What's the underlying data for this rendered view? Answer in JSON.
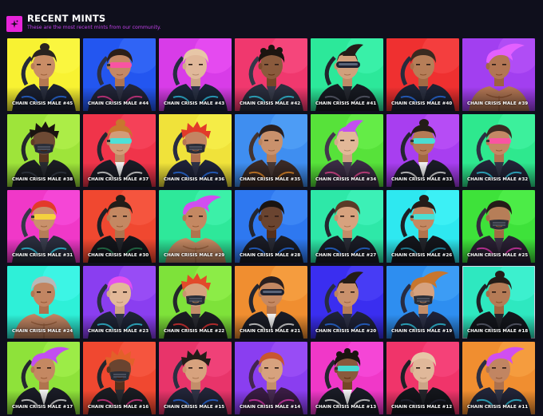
{
  "header": {
    "title": "RECENT MINTS",
    "subtitle": "These are the most recent mints from our community.",
    "logo_icon": "sparkle-icon"
  },
  "colors": {
    "accent": "#e724d9",
    "subtitle": "#c040e8",
    "background": "#0f0f1c"
  },
  "mints": [
    {
      "name": "CHAIN CRISIS MALE #45",
      "bg": "#f8f232",
      "skin": "#c98d66",
      "hair": "#2a2320",
      "jacket": "#1b2030",
      "accent": "#2e7bff",
      "eyewear": "none",
      "style": "bun"
    },
    {
      "name": "CHAIN CRISIS MALE #44",
      "bg": "#2356f0",
      "skin": "#c48865",
      "hair": "#2c1e18",
      "jacket": "#222538",
      "accent": "#ff3fa0",
      "eyewear": "goggles-pink",
      "style": "short"
    },
    {
      "name": "CHAIN CRISIS MALE #43",
      "bg": "#d83ce8",
      "skin": "#e0b89a",
      "hair": "#e7c6a7",
      "jacket": "#1b2337",
      "accent": "#36d8ff",
      "eyewear": "none",
      "style": "short"
    },
    {
      "name": "CHAIN CRISIS MALE #42",
      "bg": "#f0386e",
      "skin": "#8a5a3c",
      "hair": "#1c1410",
      "jacket": "#2a2e3e",
      "accent": "#38e0ff",
      "eyewear": "none",
      "style": "curly"
    },
    {
      "name": "CHAIN CRISIS MALE #41",
      "bg": "#2ce89a",
      "skin": "#d1a07c",
      "hair": "#241c18",
      "jacket": "#171a22",
      "accent": "#6a6f80",
      "eyewear": "visor-dark",
      "style": "mohawk"
    },
    {
      "name": "CHAIN CRISIS MALE #40",
      "bg": "#ef3030",
      "skin": "#b67e58",
      "hair": "#3a2a20",
      "jacket": "#1d2233",
      "accent": "#2e7bff",
      "eyewear": "none",
      "style": "short"
    },
    {
      "name": "CHAIN CRISIS MALE #39",
      "bg": "#a23ff0",
      "skin": "#b27654",
      "hair": "#e360ff",
      "jacket": "none",
      "accent": "#c06fff",
      "eyewear": "none",
      "style": "swept"
    },
    {
      "name": "CHAIN CRISIS MALE #38",
      "bg": "#9ee43a",
      "skin": "#6e4a34",
      "hair": "#1a1410",
      "jacket": "#1a1c22",
      "accent": "#3a3f4c",
      "eyewear": "mask",
      "style": "spiky"
    },
    {
      "name": "CHAIN CRISIS MALE #37",
      "bg": "#f0344a",
      "skin": "#d39c78",
      "hair": "#c8762e",
      "jacket": "#1a1c26",
      "accent": "#ffffff",
      "eyewear": "goggles-cyan",
      "style": "bun"
    },
    {
      "name": "CHAIN CRISIS MALE #36",
      "bg": "#f0e23a",
      "skin": "#c48462",
      "hair": "#e23a2a",
      "jacket": "#1e2238",
      "accent": "#2e7bff",
      "eyewear": "mask",
      "style": "spiky"
    },
    {
      "name": "CHAIN CRISIS MALE #35",
      "bg": "#3f8ef0",
      "skin": "#c9916c",
      "hair": "#2a2020",
      "jacket": "#3a2a26",
      "accent": "#ff9a2e",
      "eyewear": "none",
      "style": "short"
    },
    {
      "name": "CHAIN CRISIS MALE #34",
      "bg": "#57e23a",
      "skin": "#e2b898",
      "hair": "#c24ff0",
      "jacket": "#3a2c44",
      "accent": "#ff4fa0",
      "eyewear": "none",
      "style": "mohawk"
    },
    {
      "name": "CHAIN CRISIS MALE #33",
      "bg": "#a83ef0",
      "skin": "#b57b56",
      "hair": "#241c18",
      "jacket": "#1a1c26",
      "accent": "#ffffff",
      "eyewear": "goggles-cyan",
      "style": "bun"
    },
    {
      "name": "CHAIN CRISIS MALE #32",
      "bg": "#2ee88e",
      "skin": "#c48865",
      "hair": "#3a2a22",
      "jacket": "#222538",
      "accent": "#38e0ff",
      "eyewear": "goggles-pink",
      "style": "short"
    },
    {
      "name": "CHAIN CRISIS MALE #31",
      "bg": "#f038c8",
      "skin": "#c9916c",
      "hair": "#e23a2a",
      "jacket": "#2a2e3e",
      "accent": "#38e0ff",
      "eyewear": "goggles-yellow",
      "style": "short"
    },
    {
      "name": "CHAIN CRISIS MALE #30",
      "bg": "#f04830",
      "skin": "#c48862",
      "hair": "#241c18",
      "jacket": "#14161c",
      "accent": "#2a8c5a",
      "eyewear": "none",
      "style": "bun"
    },
    {
      "name": "CHAIN CRISIS MALE #29",
      "bg": "#2ee89a",
      "skin": "#c48862",
      "hair": "#d04ff0",
      "jacket": "none",
      "accent": "#c06fff",
      "eyewear": "none",
      "style": "swept"
    },
    {
      "name": "CHAIN CRISIS MALE #28",
      "bg": "#2e78f0",
      "skin": "#6a4430",
      "hair": "#1a1410",
      "jacket": "#1a1c26",
      "accent": "#2e7bff",
      "eyewear": "none",
      "style": "short"
    },
    {
      "name": "CHAIN CRISIS MALE #27",
      "bg": "#2ee8a8",
      "skin": "#d7a27e",
      "hair": "#5a3a26",
      "jacket": "#1a1c26",
      "accent": "#2e7bff",
      "eyewear": "none",
      "style": "short"
    },
    {
      "name": "CHAIN CRISIS MALE #26",
      "bg": "#2ee8f0",
      "skin": "#c48862",
      "hair": "#241c18",
      "jacket": "#14161c",
      "accent": "#2ea8c8",
      "eyewear": "goggles-cyan",
      "style": "bun"
    },
    {
      "name": "CHAIN CRISIS MALE #25",
      "bg": "#3ee23a",
      "skin": "#b67e58",
      "hair": "#241c18",
      "jacket": "#2a2034",
      "accent": "#ff3fc8",
      "eyewear": "mask",
      "style": "short"
    },
    {
      "name": "CHAIN CRISIS MALE #24",
      "bg": "#2ef0d8",
      "skin": "#c18562",
      "hair": "#b8b8b8",
      "jacket": "none",
      "accent": "#888888",
      "eyewear": "none",
      "style": "short"
    },
    {
      "name": "CHAIN CRISIS MALE #23",
      "bg": "#8a3ef0",
      "skin": "#e2b898",
      "hair": "#e24ff0",
      "jacket": "#1e2436",
      "accent": "#38e0ff",
      "eyewear": "none",
      "style": "short"
    },
    {
      "name": "CHAIN CRISIS MALE #22",
      "bg": "#7ee23a",
      "skin": "#d7a27e",
      "hair": "#e24a2a",
      "jacket": "#1a1c22",
      "accent": "#ff3a3a",
      "eyewear": "mask",
      "style": "spiky"
    },
    {
      "name": "CHAIN CRISIS MALE #21",
      "bg": "#f08e30",
      "skin": "#c48862",
      "hair": "#2a2020",
      "jacket": "#1a1c26",
      "accent": "#ffffff",
      "eyewear": "visor-dark",
      "style": "short"
    },
    {
      "name": "CHAIN CRISIS MALE #20",
      "bg": "#3a2ef0",
      "skin": "#c9916c",
      "hair": "#241c18",
      "jacket": "#1e2238",
      "accent": "#2e7bff",
      "eyewear": "none",
      "style": "mohawk"
    },
    {
      "name": "CHAIN CRISIS MALE #19",
      "bg": "#2e8ef0",
      "skin": "#d7a27e",
      "hair": "#c8762e",
      "jacket": "#1e2238",
      "accent": "#38e0ff",
      "eyewear": "mask",
      "style": "swept"
    },
    {
      "name": "CHAIN CRISIS MALE #18",
      "bg": "#2ee8c0",
      "skin": "#b57b56",
      "hair": "#241c18",
      "jacket": "#14161c",
      "accent": "#6a6f80",
      "eyewear": "none",
      "style": "bun",
      "selected": true
    },
    {
      "name": "CHAIN CRISIS MALE #17",
      "bg": "#8ee23a",
      "skin": "#c48862",
      "hair": "#c24ff0",
      "jacket": "#1a1c26",
      "accent": "#ffffff",
      "eyewear": "none",
      "style": "swept"
    },
    {
      "name": "CHAIN CRISIS MALE #16",
      "bg": "#f04830",
      "skin": "#6a4430",
      "hair": "#e2602a",
      "jacket": "#1a1c22",
      "accent": "#ff3fa0",
      "eyewear": "mask",
      "style": "spiky"
    },
    {
      "name": "CHAIN CRISIS MALE #15",
      "bg": "#e8346a",
      "skin": "#d7a27e",
      "hair": "#241c18",
      "jacket": "#222538",
      "accent": "#2e7bff",
      "eyewear": "none",
      "style": "spiky"
    },
    {
      "name": "CHAIN CRISIS MALE #14",
      "bg": "#8a3ef0",
      "skin": "#d7a27e",
      "hair": "#c8562e",
      "jacket": "#3a1c44",
      "accent": "#ff3fc8",
      "eyewear": "none",
      "style": "short"
    },
    {
      "name": "CHAIN CRISIS MALE #13",
      "bg": "#f038c8",
      "skin": "#8a5a3c",
      "hair": "#1a1410",
      "jacket": "#1a1c26",
      "accent": "#ffffff",
      "eyewear": "goggles-cyan",
      "style": "curly"
    },
    {
      "name": "CHAIN CRISIS MALE #12",
      "bg": "#f0346a",
      "skin": "#e0b89a",
      "hair": "#e7c6a7",
      "jacket": "#14161c",
      "accent": "#2a2e3e",
      "eyewear": "none",
      "style": "short"
    },
    {
      "name": "CHAIN CRISIS MALE #11",
      "bg": "#f08e30",
      "skin": "#c18562",
      "hair": "#d04ff0",
      "jacket": "#222538",
      "accent": "#38e0ff",
      "eyewear": "none",
      "style": "swept"
    }
  ]
}
